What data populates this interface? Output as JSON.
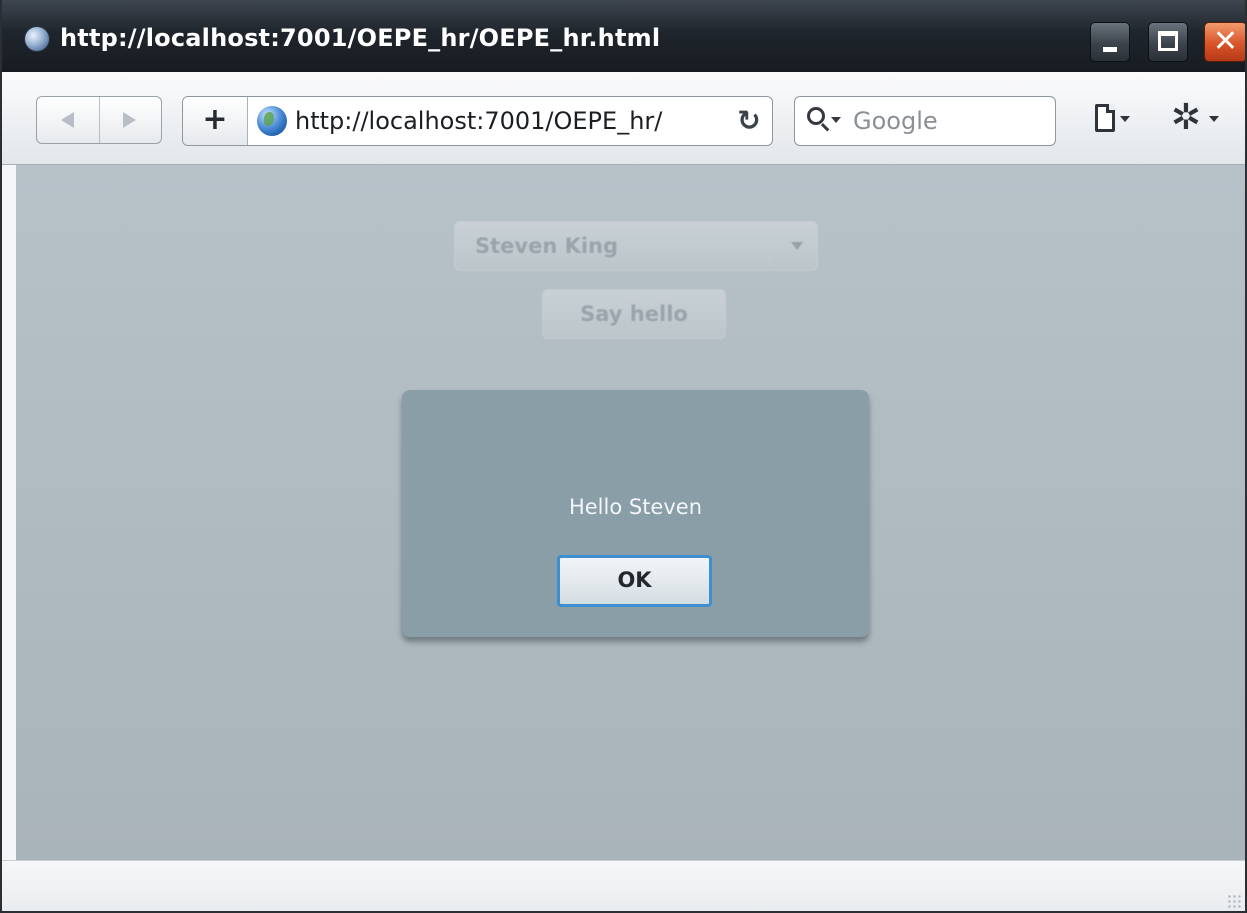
{
  "window": {
    "title": "http://localhost:7001/OEPE_hr/OEPE_hr.html",
    "close_glyph": "✕"
  },
  "toolbar": {
    "add_glyph": "+",
    "url": "http://localhost:7001/OEPE_hr/",
    "reload_glyph": "↻",
    "search_placeholder": "Google",
    "gear_glyph": "✲"
  },
  "page": {
    "select_value": "Steven King",
    "say_hello_label": "Say hello"
  },
  "dialog": {
    "message": "Hello Steven",
    "ok_label": "OK"
  },
  "colors": {
    "content_bg": "#b0bbc1",
    "dialog_bg": "#8a9ea8",
    "ok_focus_border": "#3d8fd0",
    "close_button": "#d9542a"
  },
  "icons": [
    "page-globe-icon",
    "globe-icon",
    "back-arrow-icon",
    "forward-arrow-icon",
    "reload-icon",
    "search-icon",
    "page-icon",
    "gear-icon",
    "minimize-icon",
    "maximize-icon",
    "close-icon"
  ]
}
